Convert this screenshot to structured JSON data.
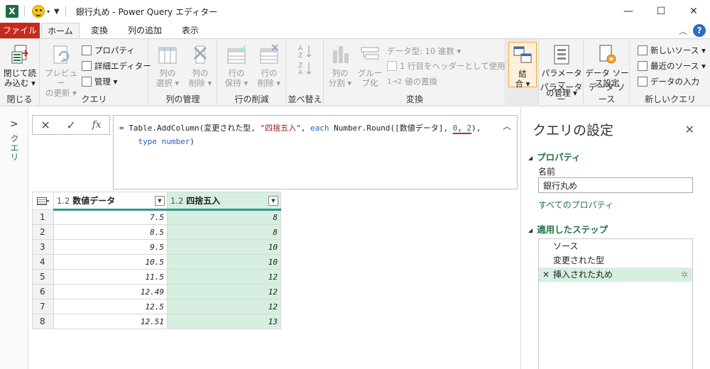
{
  "window": {
    "app_icon_text": "X",
    "title": "銀行丸め - Power Query エディター",
    "minimize": "—",
    "maximize": "☐",
    "close": "✕"
  },
  "tabs": {
    "file": "ファイル",
    "home": "ホーム",
    "transform": "変換",
    "add_column": "列の追加",
    "view": "表示",
    "help": "?"
  },
  "ribbon": {
    "close": {
      "label1": "閉じて読",
      "label2": "み込む ▾",
      "group": "閉じる"
    },
    "query": {
      "preview": [
        "プレビュー",
        "の更新 ▾"
      ],
      "properties": "プロパティ",
      "advanced_editor": "詳細エディター",
      "manage": "管理 ▾",
      "group": "クエリ"
    },
    "manage_columns": {
      "choose": [
        "列の",
        "選択 ▾"
      ],
      "remove": [
        "列の",
        "削除 ▾"
      ],
      "group": "列の管理"
    },
    "reduce_rows": {
      "keep": [
        "行の",
        "保持 ▾"
      ],
      "remove": [
        "行の",
        "削除 ▾"
      ],
      "group": "行の削減"
    },
    "sort": {
      "group": "並べ替え"
    },
    "transform": {
      "split": [
        "列の",
        "分割 ▾"
      ],
      "group_by": [
        "グルー",
        "プ化"
      ],
      "data_type": "データ型: 10 進数 ▾",
      "first_row_header": "1 行目をヘッダーとして使用 ▾",
      "replace_values": "値の置換",
      "group": "変換"
    },
    "combine": {
      "label": [
        "結",
        "合 ▾"
      ]
    },
    "parameters": {
      "label": [
        "パラメーター",
        "の管理 ▾"
      ],
      "group": "パラメーター"
    },
    "data_source": {
      "label": [
        "データ ソー",
        "ス設定"
      ],
      "group": "データ ソース"
    },
    "new_query": {
      "new_source": "新しいソース ▾",
      "recent_sources": "最近のソース ▾",
      "enter_data": "データの入力",
      "group": "新しいクエリ"
    }
  },
  "query_pane": {
    "label": "クエリ"
  },
  "formula_bar": {
    "cancel": "✕",
    "commit": "✓",
    "fx": "fx",
    "text": "= Table.AddColumn(変更された型, \"四捨五入\", each Number.Round([数値データ], 0, 2), type number)",
    "parts": {
      "p1": "= Table.AddColumn(変更された型, ",
      "p2": "\"四捨五入\"",
      "p3": ", ",
      "p4": "each",
      "p5": " Number.Round([数値データ], ",
      "p6": "0",
      "p7": ", ",
      "p8": "2",
      "p9": "),",
      "p10": "type",
      "p11": " ",
      "p12": "number",
      "p13": ")"
    }
  },
  "grid": {
    "columns": [
      {
        "type": "1.2",
        "name": "数値データ"
      },
      {
        "type": "1.2",
        "name": "四捨五入"
      }
    ],
    "rows": [
      {
        "n": "1",
        "a": "7.5",
        "b": "8"
      },
      {
        "n": "2",
        "a": "8.5",
        "b": "8"
      },
      {
        "n": "3",
        "a": "9.5",
        "b": "10"
      },
      {
        "n": "4",
        "a": "10.5",
        "b": "10"
      },
      {
        "n": "5",
        "a": "11.5",
        "b": "12"
      },
      {
        "n": "6",
        "a": "12.49",
        "b": "12"
      },
      {
        "n": "7",
        "a": "12.5",
        "b": "12"
      },
      {
        "n": "8",
        "a": "12.51",
        "b": "13"
      }
    ]
  },
  "settings": {
    "title": "クエリの設定",
    "properties_header": "プロパティ",
    "name_label": "名前",
    "name_value": "銀行丸め",
    "all_properties": "すべてのプロパティ",
    "steps_header": "適用したステップ",
    "steps": [
      "ソース",
      "変更された型",
      "挿入された丸め"
    ]
  },
  "colors": {
    "accent": "#217346",
    "file_tab": "#c42b1c",
    "selected_column": "#d6efe0"
  }
}
